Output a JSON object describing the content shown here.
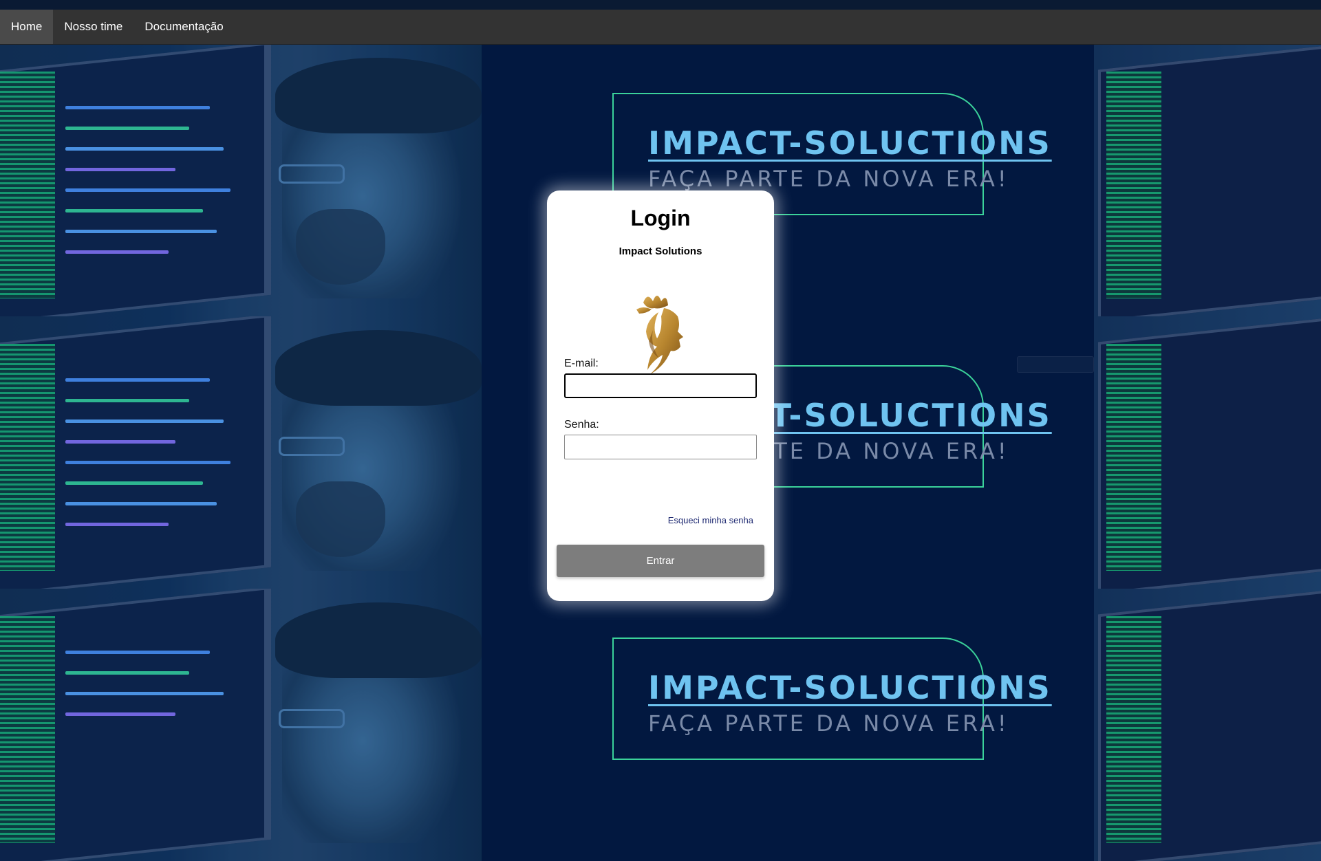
{
  "nav": {
    "items": [
      {
        "label": "Home",
        "active": true
      },
      {
        "label": "Nosso time",
        "active": false
      },
      {
        "label": "Documentação",
        "active": false
      }
    ]
  },
  "banner": {
    "title": "IMPACT-SOLUCTIONS",
    "subtitle": "FAÇA PARTE DA NOVA ERA!",
    "partial_title": "SOLUCTIONS",
    "partial_subtitle": "DA NOVA ERA!"
  },
  "login": {
    "title": "Login",
    "subtitle": "Impact Solutions",
    "logo_icon": "woman-profile-lotus-logo",
    "email_label": "E-mail:",
    "email_value": "",
    "password_label": "Senha:",
    "password_value": "",
    "forgot_label": "Esqueci minha senha",
    "submit_label": "Entrar"
  },
  "colors": {
    "background": "#021840",
    "navbar": "#333333",
    "banner_border": "#3bd29a",
    "banner_title": "#6fc3f0",
    "banner_subtitle": "#7a8aa8",
    "submit_button": "#7d7d7d",
    "forgot_link": "#1f2a72",
    "logo_gold": "#b8862f"
  }
}
